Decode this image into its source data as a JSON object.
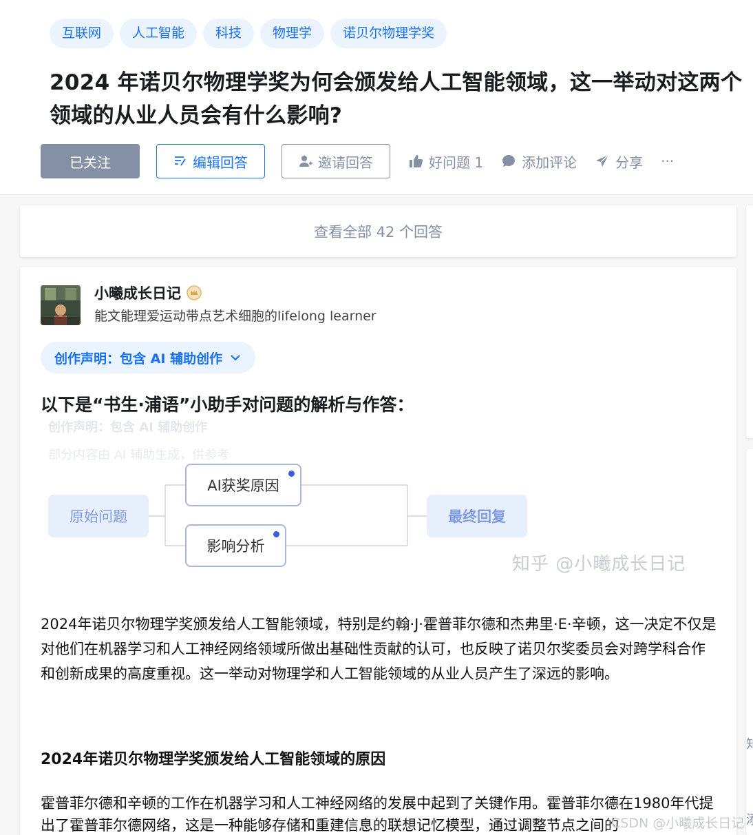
{
  "tags": [
    "互联网",
    "人工智能",
    "科技",
    "物理学",
    "诺贝尔物理学奖"
  ],
  "question_title": "2024 年诺贝尔物理学奖为何会颁发给人工智能领域，这一举动对这两个领域的从业人员会有什么影响?",
  "actions": {
    "follow": "已关注",
    "edit_answer": "编辑回答",
    "invite": "邀请回答",
    "good_question": "好问题 1",
    "comment": "添加评论",
    "share": "分享",
    "more": "···"
  },
  "view_all": "查看全部 42 个回答",
  "author": {
    "name": "小曦成长日记",
    "bio": "能文能理爱运动带点艺术细胞的lifelong learner"
  },
  "creation_statement": "创作声明：包含 AI 辅助创作",
  "content": {
    "intro_title": "以下是“书生·浦语”小助手对问题的解析与作答：",
    "ghost_line1": "创作声明：包含 AI 辅助创作",
    "ghost_line2": "部分内容由 AI 辅助生成，供参考",
    "mindmap": {
      "root": "原始问题",
      "branch_a": "AI获奖原因",
      "branch_b": "影响分析",
      "final": "最终回复"
    },
    "watermark": "知乎 @小曦成长日记",
    "paragraph1": "2024年诺贝尔物理学奖颁发给人工智能领域，特别是约翰·J·霍普菲尔德和杰弗里·E·辛顿，这一决定不仅是对他们在机器学习和人工神经网络领域所做出基础性贡献的认可，也反映了诺贝尔奖委员会对跨学科合作和创新成果的高度重视。这一举动对物理学和人工智能领域的从业人员产生了深远的影响。",
    "section_title": "2024年诺贝尔物理学奖颁发给人工智能领域的原因",
    "paragraph2": "霍普菲尔德和辛顿的工作在机器学习和人工神经网络的发展中起到了关键作用。霍普菲尔德在1980年代提出了霍普菲尔德网络，这是一种能够存储和重建信息的联想记忆模型，通过调整节点之间的",
    "csdn_watermark": "CSDN @小曦成长日记"
  },
  "side": {
    "glyph1": "知",
    "glyph2": "添"
  },
  "colors": {
    "accent": "#1772f6",
    "muted": "#8590a6",
    "tag_bg": "#ebf3ff"
  }
}
